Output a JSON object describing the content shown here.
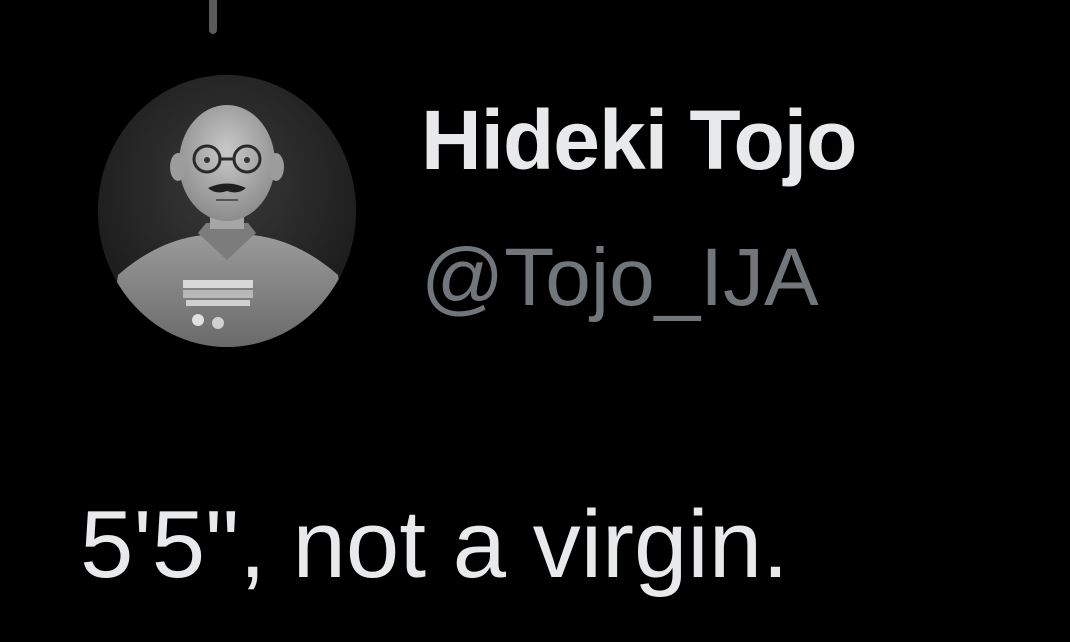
{
  "tweet": {
    "author": {
      "display_name": "Hideki Tojo",
      "handle": "@Tojo_IJA",
      "avatar_icon": "profile-photo"
    },
    "text": "5'5\", not a virgin."
  },
  "colors": {
    "background": "#000000",
    "primary_text": "#e7e9ea",
    "secondary_text": "#71767b",
    "thread_line": "#5a5a5a"
  }
}
